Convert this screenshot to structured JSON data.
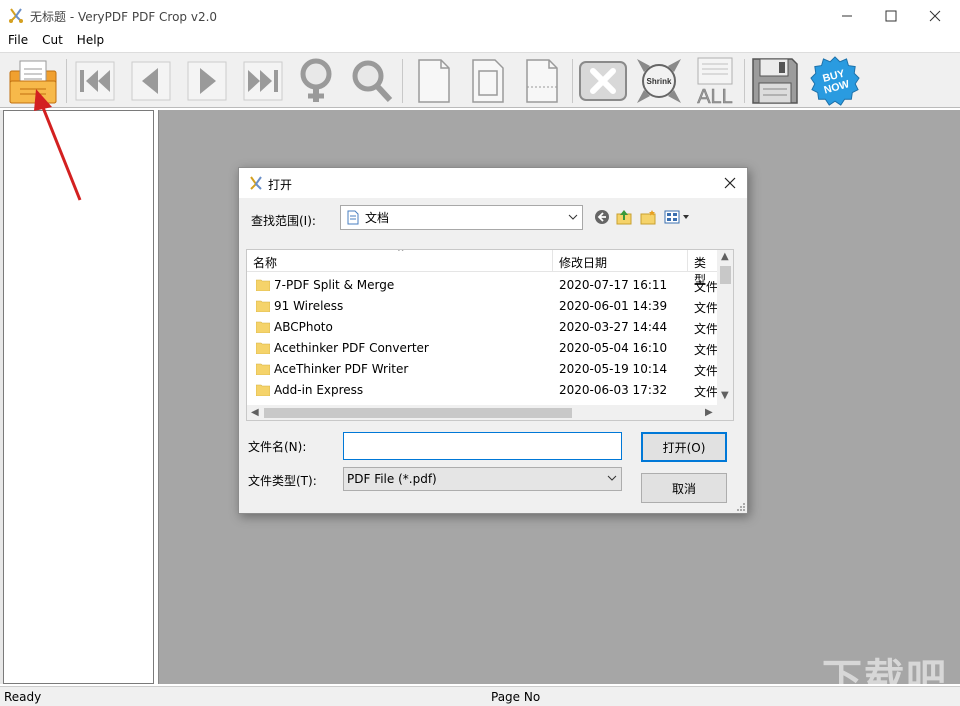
{
  "window": {
    "title": "无标题 - VeryPDF PDF Crop v2.0",
    "minimize_icon": "minimize-icon",
    "maximize_icon": "maximize-icon",
    "close_icon": "close-icon"
  },
  "menu": {
    "items": [
      "File",
      "Cut",
      "Help"
    ]
  },
  "toolbar": {
    "buttons": [
      {
        "name": "open-file",
        "icon": "open-folder-icon"
      },
      {
        "name": "first-page",
        "icon": "first-page-icon"
      },
      {
        "name": "previous-page",
        "icon": "previous-page-icon"
      },
      {
        "name": "next-page",
        "icon": "next-page-icon"
      },
      {
        "name": "last-page",
        "icon": "last-page-icon"
      },
      {
        "name": "zoom-in",
        "icon": "zoom-in-icon"
      },
      {
        "name": "zoom-out",
        "icon": "zoom-out-icon"
      },
      {
        "name": "page-1",
        "icon": "page-icon"
      },
      {
        "name": "page-2",
        "icon": "page-icon"
      },
      {
        "name": "page-3",
        "icon": "page-icon"
      },
      {
        "name": "delete",
        "icon": "delete-icon"
      },
      {
        "name": "shrink",
        "icon": "shrink-icon"
      },
      {
        "name": "all-pages",
        "icon": "all-pages-icon"
      },
      {
        "name": "save",
        "icon": "floppy-disk-icon"
      },
      {
        "name": "buy-now",
        "icon": "buy-now-badge-icon"
      }
    ],
    "shrink_label": "Shrink",
    "all_label": "ALL",
    "buy_label_1": "BUY",
    "buy_label_2": "NOW"
  },
  "status": {
    "left": "Ready",
    "center": "Page No"
  },
  "dialog": {
    "title": "打开",
    "look_in_label": "查找范围(I):",
    "look_in_value": "文档",
    "columns": {
      "name": "名称",
      "date": "修改日期",
      "type": "类型"
    },
    "files": [
      {
        "name": "7-PDF Split & Merge",
        "date": "2020-07-17 16:11",
        "type": "文件"
      },
      {
        "name": "91 Wireless",
        "date": "2020-06-01 14:39",
        "type": "文件"
      },
      {
        "name": "ABCPhoto",
        "date": "2020-03-27 14:44",
        "type": "文件"
      },
      {
        "name": "Acethinker PDF Converter",
        "date": "2020-05-04 16:10",
        "type": "文件"
      },
      {
        "name": "AceThinker PDF Writer",
        "date": "2020-05-19 10:14",
        "type": "文件"
      },
      {
        "name": "Add-in Express",
        "date": "2020-06-03 17:32",
        "type": "文件"
      }
    ],
    "file_name_label": "文件名(N):",
    "file_name_value": "",
    "file_type_label": "文件类型(T):",
    "file_type_value": "PDF File (*.pdf)",
    "open_button": "打开(O)",
    "cancel_button": "取消"
  },
  "watermark": "下载吧",
  "colors": {
    "accent": "#0078d7",
    "main_bg": "#a6a6a6",
    "arrow": "#d32020"
  }
}
